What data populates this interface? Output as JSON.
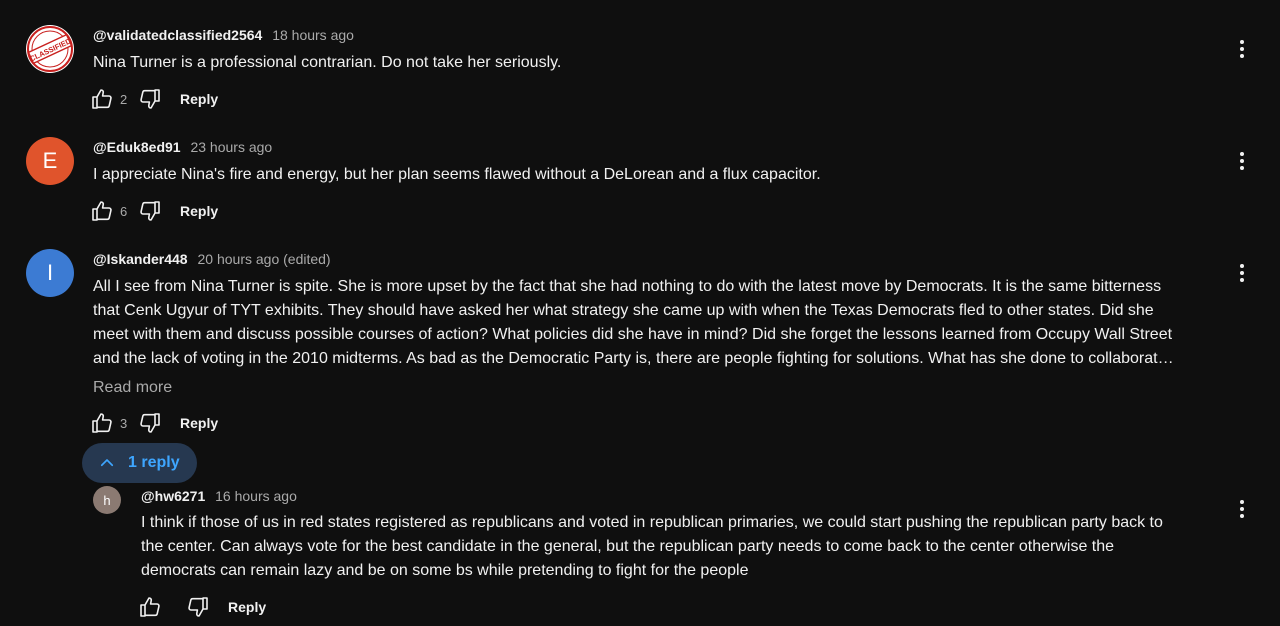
{
  "colors": {
    "background": "#0f0f0f",
    "accent_blue": "#3ea6ff",
    "avatar_e": "#e0542c",
    "avatar_i": "#3c7bd3",
    "avatar_h": "#8b7a72"
  },
  "icons": {
    "like": "thumb-up-outline",
    "dislike": "thumb-down-outline",
    "more": "three-dot-vertical",
    "collapse": "chevron-up"
  },
  "comments": [
    {
      "author": "@validatedclassified2564",
      "time": "18 hours ago",
      "avatar_initial": "",
      "avatar_text": "CLASSIFIED",
      "text": "Nina Turner is a professional contrarian. Do not take her seriously.",
      "likes": "2",
      "reply_label": "Reply"
    },
    {
      "author": "@Eduk8ed91",
      "time": "23 hours ago",
      "avatar_initial": "E",
      "text": "I appreciate Nina's fire and energy, but her plan seems flawed without a DeLorean and a flux capacitor.",
      "likes": "6",
      "reply_label": "Reply"
    },
    {
      "author": "@Iskander448",
      "time": "20 hours ago (edited)",
      "avatar_initial": "I",
      "text_lines": [
        "All I see from Nina Turner is spite. She is more upset by the fact that she had nothing to do with the latest move by Democrats. It is the same bitterness",
        "that Cenk Ugyur of TYT exhibits. They should have asked her what strategy she came up with when the Texas Democrats fled to other states. Did she",
        "meet with them and discuss possible courses of action? What policies did she have in mind? Did she forget the lessons learned from Occupy Wall Street",
        "and the lack of voting in the 2010 midterms. As bad as the Democratic Party is, there are people fighting for solutions. What has she done to collaborat…"
      ],
      "read_more": "Read more",
      "likes": "3",
      "reply_label": "Reply",
      "replies_toggle": "1 reply"
    }
  ],
  "reply": {
    "author": "@hw6271",
    "time": "16 hours ago",
    "avatar_initial": "h",
    "text_lines": [
      "I think if those of us in red states registered as republicans and voted in republican primaries, we could start pushing the republican party back to",
      "the center. Can always vote for the best candidate in the general, but the republican party needs to come back to the center otherwise the",
      "democrats can remain lazy and be on some bs while pretending to fight for the people"
    ],
    "likes": "",
    "reply_label": "Reply"
  }
}
